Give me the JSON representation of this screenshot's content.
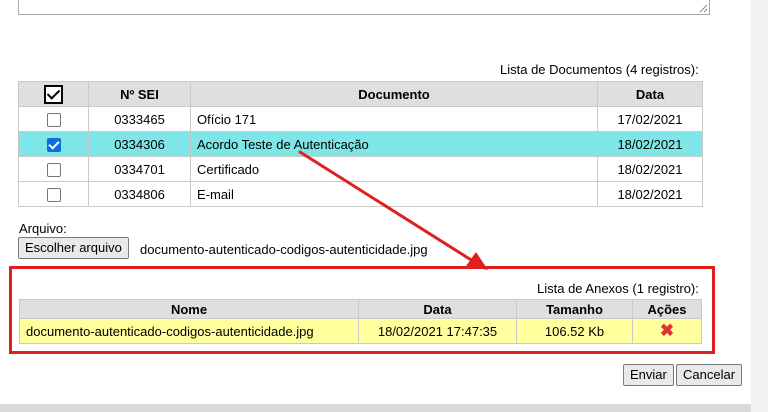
{
  "documents": {
    "caption": "Lista de Documentos (4 registros):",
    "columns": {
      "sei": "Nº SEI",
      "documento": "Documento",
      "data": "Data"
    },
    "rows": [
      {
        "sei": "0333465",
        "documento": "Ofício 171",
        "data": "17/02/2021",
        "checked": false
      },
      {
        "sei": "0334306",
        "documento": "Acordo Teste de Autenticação",
        "data": "18/02/2021",
        "checked": true
      },
      {
        "sei": "0334701",
        "documento": "Certificado",
        "data": "18/02/2021",
        "checked": false
      },
      {
        "sei": "0334806",
        "documento": "E-mail",
        "data": "18/02/2021",
        "checked": false
      }
    ]
  },
  "file": {
    "label": "Arquivo:",
    "button": "Escolher arquivo",
    "filename": "documento-autenticado-codigos-autenticidade.jpg"
  },
  "attachments": {
    "caption": "Lista de Anexos (1 registro):",
    "columns": {
      "nome": "Nome",
      "data": "Data",
      "tamanho": "Tamanho",
      "acoes": "Ações"
    },
    "rows": [
      {
        "nome": "documento-autenticado-codigos-autenticidade.jpg",
        "data": "18/02/2021 17:47:35",
        "tamanho": "106.52 Kb",
        "acao_icon": "delete-icon"
      }
    ]
  },
  "actions": {
    "enviar": "Enviar",
    "cancelar": "Cancelar"
  },
  "colors": {
    "selected_row": "#7ee6e6",
    "attachment_row": "#ffff9e",
    "annotation_red": "#e02020"
  }
}
